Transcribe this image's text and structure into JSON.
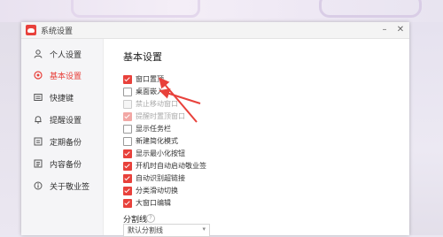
{
  "window": {
    "title": "系统设置"
  },
  "sidebar": {
    "items": [
      {
        "label": "个人设置",
        "icon": "person-icon"
      },
      {
        "label": "基本设置",
        "icon": "settings-icon",
        "active": true
      },
      {
        "label": "快捷键",
        "icon": "keyboard-icon"
      },
      {
        "label": "提醒设置",
        "icon": "bell-icon"
      },
      {
        "label": "定期备份",
        "icon": "backup-icon"
      },
      {
        "label": "内容备份",
        "icon": "content-backup-icon"
      },
      {
        "label": "关于敬业签",
        "icon": "info-icon"
      }
    ]
  },
  "main": {
    "section_title": "基本设置",
    "options": [
      {
        "label": "窗口置顶",
        "checked": true,
        "disabled": false
      },
      {
        "label": "桌面嵌入",
        "checked": false,
        "disabled": false
      },
      {
        "label": "禁止移动窗口",
        "checked": false,
        "disabled": true
      },
      {
        "label": "提醒时置顶窗口",
        "checked": true,
        "disabled": true
      },
      {
        "label": "显示任务栏",
        "checked": false,
        "disabled": false
      },
      {
        "label": "新建简化模式",
        "checked": false,
        "disabled": false
      },
      {
        "label": "显示最小化按钮",
        "checked": true,
        "disabled": false
      },
      {
        "label": "开机时自动启动敬业签",
        "checked": true,
        "disabled": false
      },
      {
        "label": "自动识别超链接",
        "checked": true,
        "disabled": false
      },
      {
        "label": "分类滑动切换",
        "checked": true,
        "disabled": false
      },
      {
        "label": "大窗口编辑",
        "checked": true,
        "disabled": false
      }
    ],
    "divider_section": {
      "title": "分割线"
    },
    "divider_select": {
      "value": "默认分割线"
    }
  },
  "colors": {
    "accent": "#e8413b"
  }
}
